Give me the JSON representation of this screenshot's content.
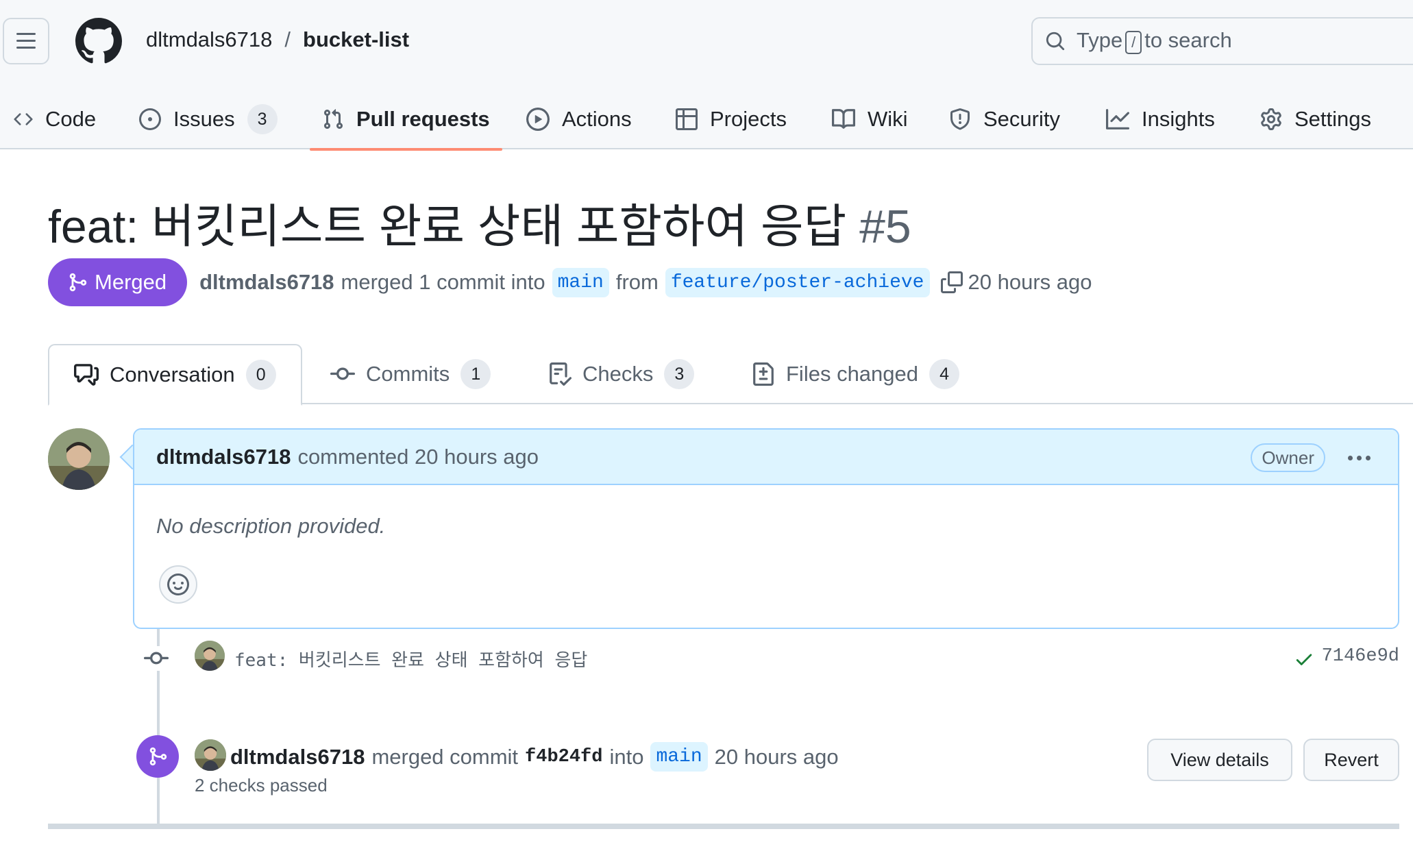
{
  "header": {
    "repo_owner": "dltmdals6718",
    "separator": "/",
    "repo_name": "bucket-list",
    "search_prefix": "Type",
    "search_key": "/",
    "search_suffix": "to search"
  },
  "nav": {
    "items": [
      {
        "label": "Code",
        "icon": "code-icon"
      },
      {
        "label": "Issues",
        "icon": "issue-icon",
        "count": "3"
      },
      {
        "label": "Pull requests",
        "icon": "pull-request-icon",
        "active": true
      },
      {
        "label": "Actions",
        "icon": "play-icon"
      },
      {
        "label": "Projects",
        "icon": "table-icon"
      },
      {
        "label": "Wiki",
        "icon": "book-icon"
      },
      {
        "label": "Security",
        "icon": "shield-icon"
      },
      {
        "label": "Insights",
        "icon": "graph-icon"
      },
      {
        "label": "Settings",
        "icon": "gear-icon"
      }
    ]
  },
  "pr": {
    "title": "feat: 버킷리스트 완료 상태 포함하여 응답",
    "number": "#5",
    "status": "Merged",
    "author": "dltmdals6718",
    "merged_text": "merged 1 commit into",
    "base_branch": "main",
    "from_text": "from",
    "head_branch": "feature/poster-achieve",
    "time": "20 hours ago"
  },
  "tabs": [
    {
      "label": "Conversation",
      "count": "0",
      "icon": "comment-discussion-icon"
    },
    {
      "label": "Commits",
      "count": "1",
      "icon": "git-commit-icon"
    },
    {
      "label": "Checks",
      "count": "3",
      "icon": "checklist-icon"
    },
    {
      "label": "Files changed",
      "count": "4",
      "icon": "file-diff-icon"
    }
  ],
  "comment": {
    "author": "dltmdals6718",
    "action": "commented 20 hours ago",
    "role": "Owner",
    "body": "No description provided."
  },
  "commit": {
    "message": "feat: 버킷리스트 완료 상태 포함하여 응답",
    "sha": "7146e9d",
    "status": "success"
  },
  "merge_event": {
    "author": "dltmdals6718",
    "text_before": "merged commit",
    "sha": "f4b24fd",
    "text_into": "into",
    "branch": "main",
    "time": "20 hours ago",
    "checks": "2 checks passed",
    "view_details_label": "View details",
    "revert_label": "Revert"
  },
  "colors": {
    "merged_purple": "#8250df",
    "accent_underline": "#fd8c73",
    "comment_header_bg": "#ddf4ff",
    "link_blue": "#0969da",
    "success_green": "#1a7f37"
  }
}
